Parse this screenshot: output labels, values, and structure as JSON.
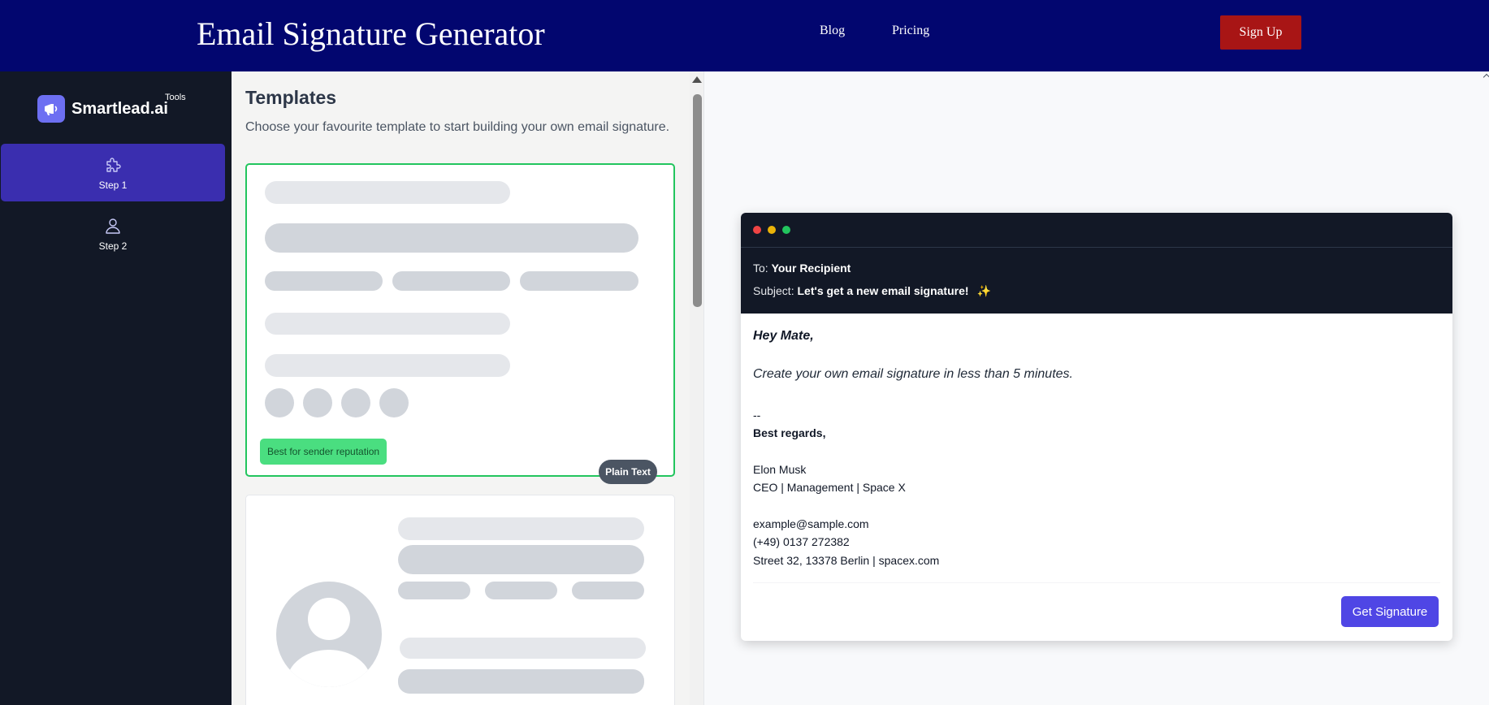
{
  "header": {
    "title": "Email Signature Generator",
    "nav": [
      "Blog",
      "Pricing"
    ],
    "signup_label": "Sign Up"
  },
  "sidebar": {
    "brand": "Smartlead.ai",
    "tools_label": "Tools",
    "steps": [
      {
        "label": "Step 1",
        "icon": "puzzle-icon",
        "active": true
      },
      {
        "label": "Step 2",
        "icon": "user-icon",
        "active": false
      }
    ]
  },
  "templates": {
    "title": "Templates",
    "subtitle": "Choose your favourite template to start building your own email signature.",
    "cards": [
      {
        "badge": "Best for sender reputation",
        "type_label": "Plain Text",
        "selected": true
      },
      {
        "selected": false
      }
    ]
  },
  "preview": {
    "to_label": "To:",
    "to_value": "Your Recipient",
    "subject_label": "Subject:",
    "subject_value": "Let's get a new email signature!",
    "subject_icon": "sparkles-icon",
    "greeting": "Hey Mate,",
    "body": "Create your own email signature in less than 5 minutes.",
    "separator": "--",
    "regards": "Best regards,",
    "name": "Elon Musk",
    "role": "CEO | Management | Space X",
    "email": "example@sample.com",
    "phone": "(+49) 0137 272382",
    "address": "Street 32, 13378 Berlin | spacex.com",
    "button_label": "Get Signature"
  },
  "colors": {
    "header_bg": "#02066f",
    "sidebar_bg": "#121826",
    "active_step": "#3a2eaf",
    "signup_bg": "#a81515",
    "selected_border": "#22c55e",
    "badge_bg": "#4ade80",
    "cta": "#4f46e5"
  }
}
